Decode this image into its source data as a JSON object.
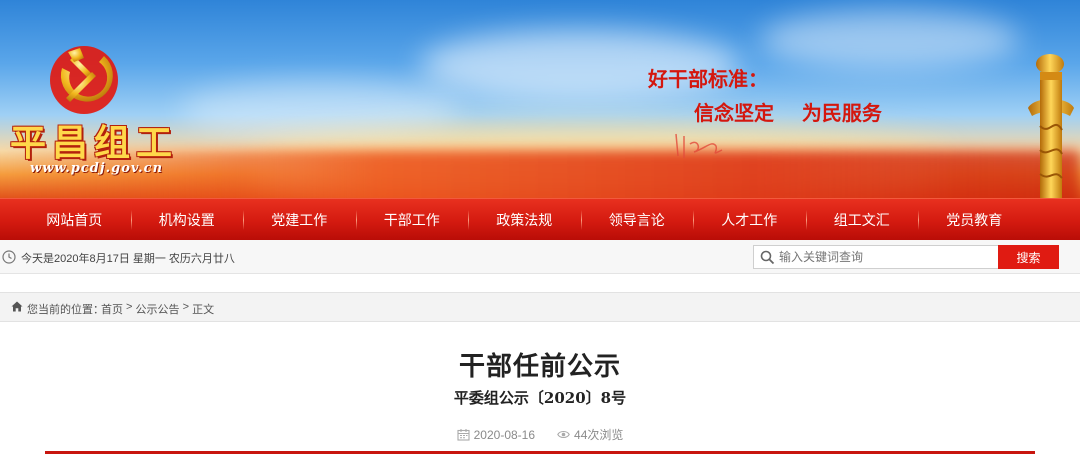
{
  "header": {
    "site_title": "平昌组工",
    "site_url": "www.pcdj.gov.cn",
    "slogan_line1": "好干部标准：",
    "slogan_line2": "信念坚定    为民服务",
    "colors": {
      "party_red": "#d4170e",
      "gold": "#ffd84a"
    }
  },
  "nav": {
    "items": [
      {
        "label": "网站首页"
      },
      {
        "label": "机构设置"
      },
      {
        "label": "党建工作"
      },
      {
        "label": "干部工作"
      },
      {
        "label": "政策法规"
      },
      {
        "label": "领导言论"
      },
      {
        "label": "人才工作"
      },
      {
        "label": "组工文汇"
      },
      {
        "label": "党员教育"
      }
    ]
  },
  "infobar": {
    "date_text": "今天是2020年8月17日 星期一 农历六月廿八",
    "search_placeholder": "输入关键词查询",
    "search_button": "搜索"
  },
  "breadcrumb": {
    "prefix": "您当前的位置：",
    "items": [
      {
        "label": "首页"
      },
      {
        "label": "公示公告"
      },
      {
        "label": "正文"
      }
    ],
    "separator": " > "
  },
  "article": {
    "title": "干部任前公示",
    "doc_number": "平委组公示〔2020〕8号",
    "date": "2020-08-16",
    "views": "44次浏览"
  },
  "icons": {
    "clock": "clock-icon",
    "search": "search-icon",
    "home": "home-icon",
    "calendar": "calendar-icon",
    "eye": "eye-icon"
  }
}
